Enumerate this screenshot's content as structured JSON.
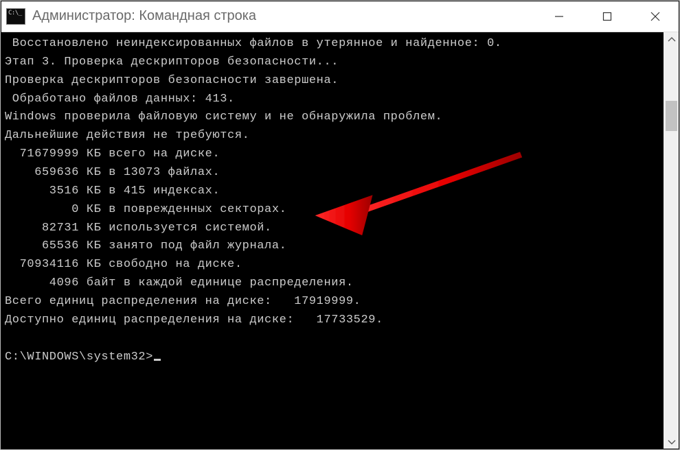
{
  "window": {
    "title": "Администратор: Командная строка"
  },
  "console": {
    "lines": [
      " Восстановлено неиндексированных файлов в утерянное и найденное: 0.",
      "",
      "",
      "Этап 3. Проверка дескрипторов безопасности...",
      "Проверка дескрипторов безопасности завершена.",
      "",
      "",
      " Обработано файлов данных: 413.",
      "",
      "Windows проверила файловую систему и не обнаружила проблем.",
      "Дальнейшие действия не требуются.",
      "",
      "  71679999 КБ всего на диске.",
      "    659636 КБ в 13073 файлах.",
      "      3516 КБ в 415 индексах.",
      "         0 КБ в поврежденных секторах.",
      "     82731 КБ используется системой.",
      "     65536 КБ занято под файл журнала.",
      "  70934116 КБ свободно на диске.",
      "",
      "      4096 байт в каждой единице распределения.",
      "Всего единиц распределения на диске:   17919999.",
      "Доступно единиц распределения на диске:   17733529."
    ],
    "prompt": "C:\\WINDOWS\\system32>"
  },
  "annotation": {
    "arrow_color": "#ff1a1a"
  }
}
